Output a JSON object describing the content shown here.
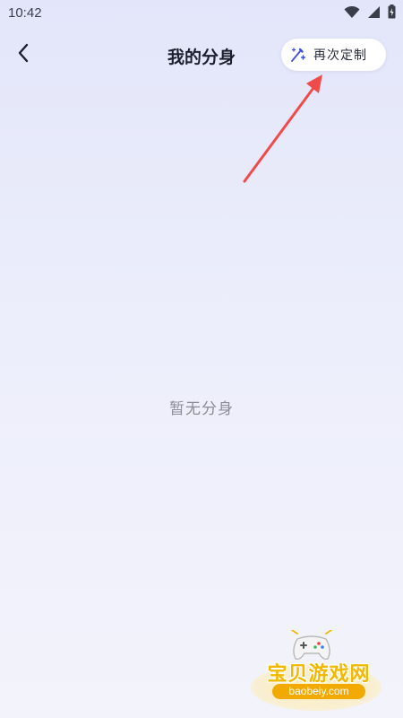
{
  "status_bar": {
    "time": "10:42",
    "icons": [
      "wifi-icon",
      "signal-icon",
      "battery-icon"
    ]
  },
  "header": {
    "back_icon": "chevron-left-icon",
    "title": "我的分身",
    "recustomize_button": {
      "icon": "magic-wand-icon",
      "label": "再次定制"
    }
  },
  "main": {
    "empty_text": "暂无分身"
  },
  "watermark": {
    "title": "宝贝游戏网",
    "domain": "baobeiy.com"
  },
  "colors": {
    "background_top": "#e3e6fa",
    "background_bottom": "#f3f3fb",
    "arrow_red": "#ef4b4b",
    "button_bg": "#ffffff",
    "watermark_gold": "#f2b800"
  }
}
